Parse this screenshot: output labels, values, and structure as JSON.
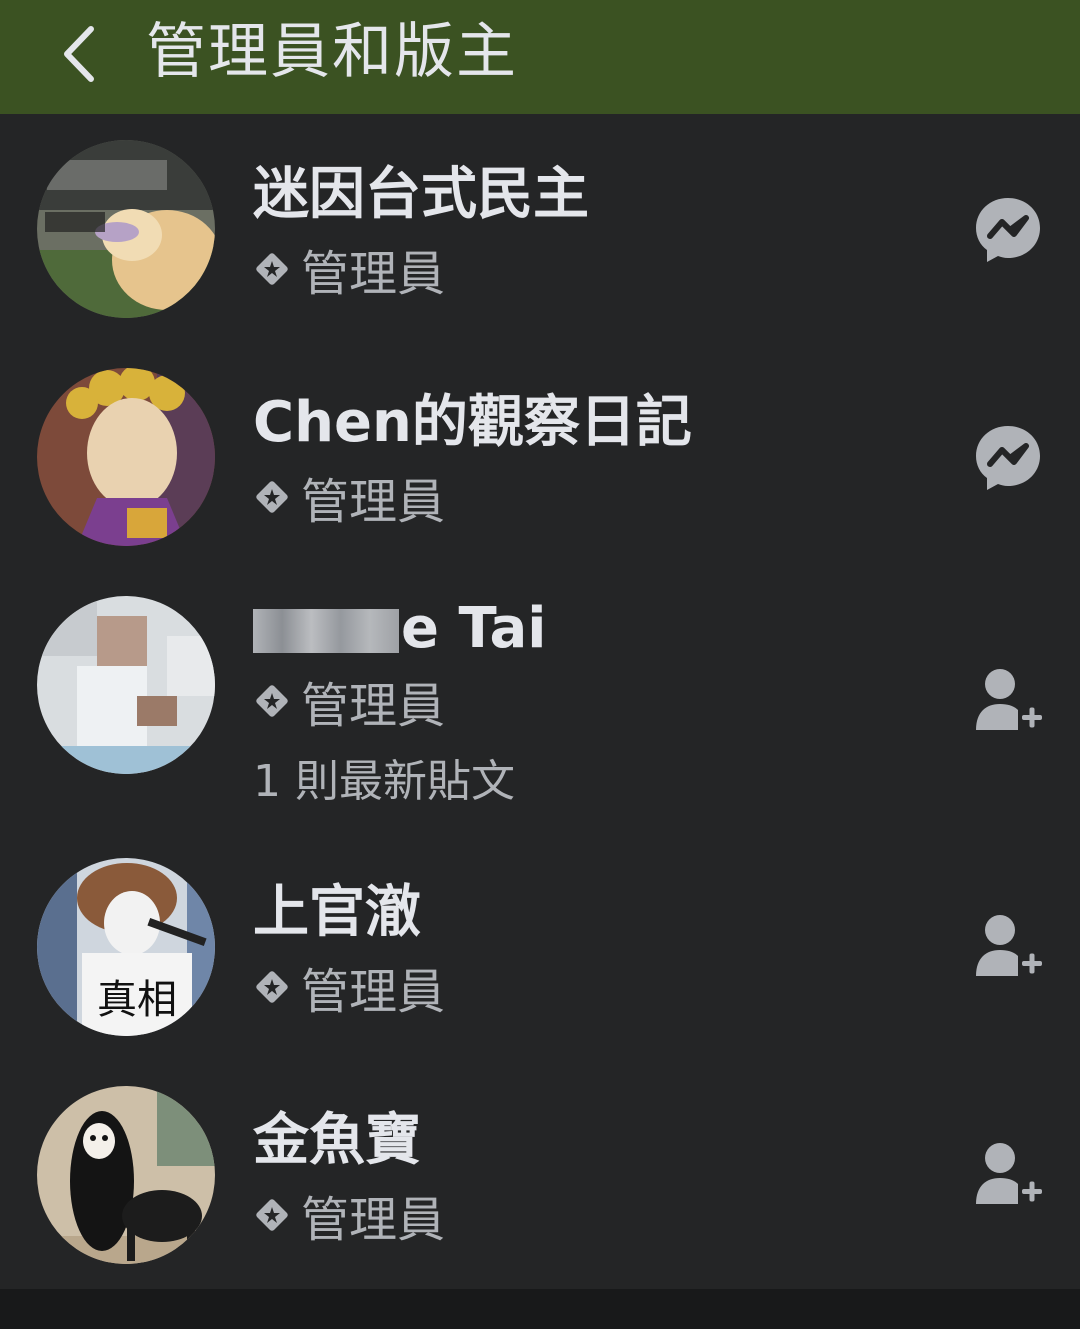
{
  "header": {
    "title": "管理員和版主"
  },
  "colors": {
    "header_bg": "#3b5222",
    "list_bg": "#242526",
    "primary_text": "#e4e6eb",
    "secondary_text": "#b0b3b8",
    "icon": "#b0b3b8"
  },
  "members": [
    {
      "name": "迷因台式民主",
      "role": "管理員",
      "action_icon": "messenger-icon",
      "avatar": "dog-meme-avatar"
    },
    {
      "name": "Chen的觀察日記",
      "role": "管理員",
      "action_icon": "messenger-icon",
      "avatar": "anime-character-avatar"
    },
    {
      "name_visible": "e Tai",
      "role": "管理員",
      "posts": "1 則最新貼文",
      "action_icon": "add-friend-icon",
      "avatar": "blurred-photo-avatar"
    },
    {
      "name": "上官澈",
      "role": "管理員",
      "action_icon": "add-friend-icon",
      "avatar": "singer-avatar"
    },
    {
      "name": "金魚寶",
      "role": "管理員",
      "action_icon": "add-friend-icon",
      "avatar": "long-hair-dog-avatar"
    }
  ]
}
